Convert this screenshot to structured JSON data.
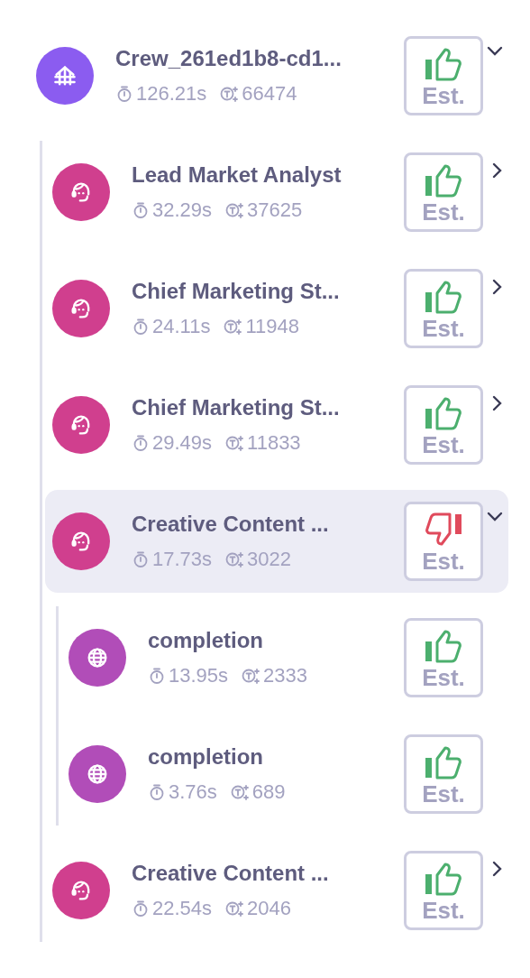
{
  "trace": {
    "kind": "crew",
    "title": "Crew_261ed1b8-cd1...",
    "duration": "126.21s",
    "tokens": "66474",
    "thumbs_up": true,
    "rating_label": "Est.",
    "expanded": true,
    "selected": false,
    "children": [
      {
        "kind": "agent",
        "title": "Lead Market Analyst",
        "duration": "32.29s",
        "tokens": "37625",
        "thumbs_up": true,
        "rating_label": "Est.",
        "expanded": false,
        "selected": false
      },
      {
        "kind": "agent",
        "title": "Chief Marketing St...",
        "duration": "24.11s",
        "tokens": "11948",
        "thumbs_up": true,
        "rating_label": "Est.",
        "expanded": false,
        "selected": false
      },
      {
        "kind": "agent",
        "title": "Chief Marketing St...",
        "duration": "29.49s",
        "tokens": "11833",
        "thumbs_up": true,
        "rating_label": "Est.",
        "expanded": false,
        "selected": false
      },
      {
        "kind": "agent",
        "title": "Creative Content ...",
        "duration": "17.73s",
        "tokens": "3022",
        "thumbs_up": false,
        "rating_label": "Est.",
        "expanded": true,
        "selected": true,
        "children": [
          {
            "kind": "llm",
            "title": "completion",
            "duration": "13.95s",
            "tokens": "2333",
            "thumbs_up": true,
            "rating_label": "Est.",
            "selected": false
          },
          {
            "kind": "llm",
            "title": "completion",
            "duration": "3.76s",
            "tokens": "689",
            "thumbs_up": true,
            "rating_label": "Est.",
            "selected": false
          }
        ]
      },
      {
        "kind": "agent",
        "title": "Creative Content ...",
        "duration": "22.54s",
        "tokens": "2046",
        "thumbs_up": true,
        "rating_label": "Est.",
        "expanded": false,
        "selected": false
      }
    ]
  }
}
